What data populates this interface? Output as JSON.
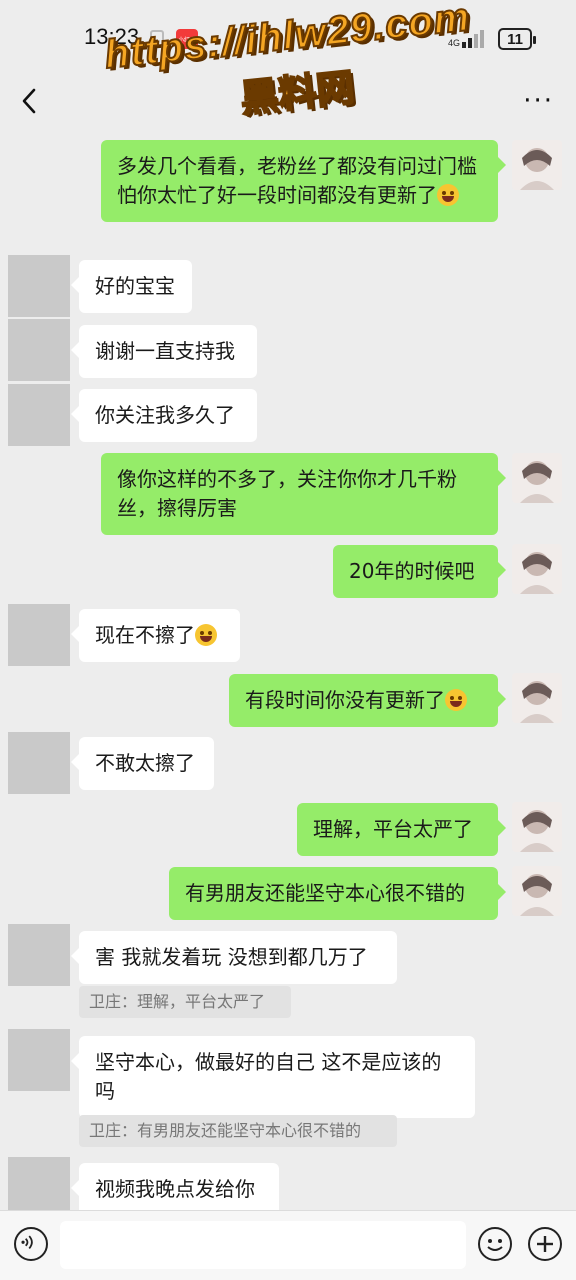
{
  "status_bar": {
    "time": "13:23",
    "app_badge": "小红书",
    "battery": "11"
  },
  "watermark": {
    "url": "https://ihlw29.com",
    "name": "黑料网"
  },
  "nav": {
    "more": "···"
  },
  "messages": [
    {
      "dir": "out",
      "text": "多发几个看看，老粉丝了都没有问过门槛怕你太忙了好一段时间都没有更新了",
      "emoji": true
    },
    {
      "dir": "in",
      "text": "好的宝宝"
    },
    {
      "dir": "in",
      "text": "谢谢一直支持我"
    },
    {
      "dir": "in",
      "text": "你关注我多久了"
    },
    {
      "dir": "out",
      "text": "像你这样的不多了，关注你你才几千粉丝，擦得厉害"
    },
    {
      "dir": "out",
      "text": "20年的时候吧"
    },
    {
      "dir": "in",
      "text": "现在不擦了",
      "emoji": true
    },
    {
      "dir": "out",
      "text": "有段时间你没有更新了",
      "emoji": true
    },
    {
      "dir": "in",
      "text": "不敢太擦了"
    },
    {
      "dir": "out",
      "text": "理解，平台太严了"
    },
    {
      "dir": "out",
      "text": "有男朋友还能坚守本心很不错的"
    },
    {
      "dir": "in",
      "text": "害 我就发着玩 没想到都几万了",
      "quote": "卫庄：理解，平台太严了"
    },
    {
      "dir": "in",
      "text": "坚守本心，做最好的自己 这不是应该的吗",
      "quote": "卫庄：有男朋友还能坚守本心很不错的"
    },
    {
      "dir": "in",
      "text": "视频我晚点发给你"
    }
  ]
}
